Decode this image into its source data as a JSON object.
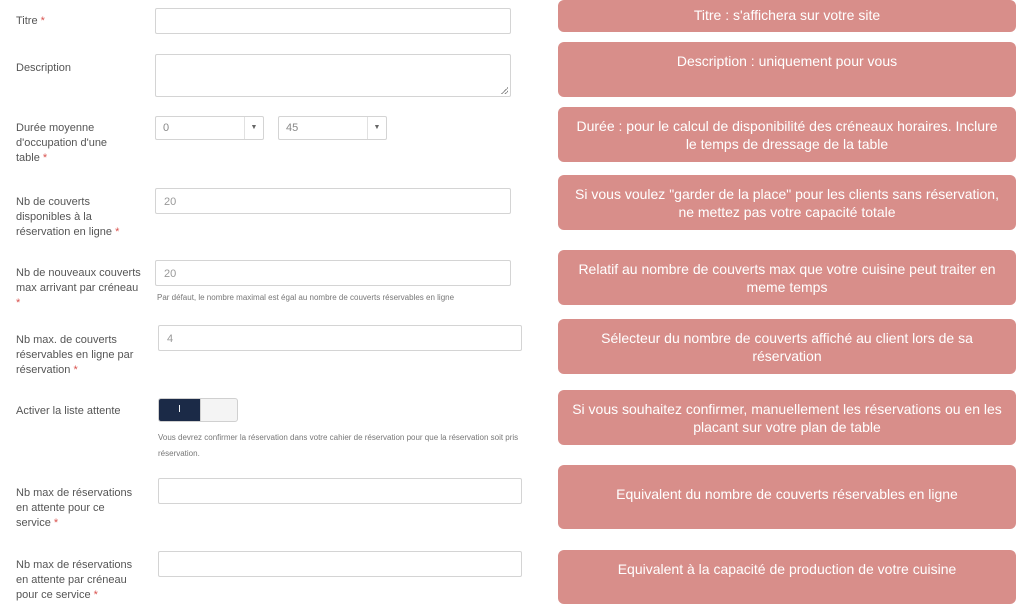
{
  "form": {
    "required_mark": "*",
    "fields": [
      {
        "label": "Titre",
        "required": true,
        "value": ""
      },
      {
        "label": "Description",
        "required": false,
        "value": ""
      },
      {
        "label": "Durée moyenne d'occupation d'une table",
        "required": true,
        "select_hours": "0",
        "select_minutes": "45"
      },
      {
        "label": "Nb de couverts disponibles à la réservation en ligne",
        "required": true,
        "value": "20"
      },
      {
        "label": "Nb de nouveaux couverts max arrivant par créneau",
        "required": true,
        "value": "20",
        "help": "Par défaut, le nombre maximal est égal au nombre de couverts réservables en ligne"
      },
      {
        "label": "Nb max. de couverts réservables en ligne par réservation",
        "required": true,
        "value": "4"
      },
      {
        "label": "Activer la liste attente",
        "required": false,
        "toggle_label": "I",
        "toggle_on": true,
        "help_line1": "Vous devrez confirmer la réservation dans votre cahier de réservation pour que la réservation soit pris",
        "help_line2": "réservation."
      },
      {
        "label": "Nb max de réservations en attente pour ce service",
        "required": true,
        "value": ""
      },
      {
        "label": "Nb max de réservations en attente par créneau pour ce service",
        "required": true,
        "value": ""
      }
    ]
  },
  "tips": [
    "Titre : s'affichera sur votre site",
    "Description : uniquement pour vous",
    "Durée : pour le calcul de disponibilité des créneaux horaires. Inclure le temps de dressage de la table",
    "Si vous voulez \"garder de la place\" pour les clients sans réservation, ne mettez pas votre capacité totale",
    "Relatif au nombre de couverts max que votre cuisine peut traiter en meme temps",
    "Sélecteur du nombre de couverts affiché au client lors de sa réservation",
    "Si vous souhaitez confirmer, manuellement les réservations ou en les placant sur votre plan de table",
    "Equivalent du nombre de couverts réservables en ligne",
    "Equivalent à la capacité de production de votre cuisine"
  ],
  "colors": {
    "tip_background": "#d88e8a",
    "required_mark": "#d9534f",
    "toggle_on": "#1b2a47"
  }
}
